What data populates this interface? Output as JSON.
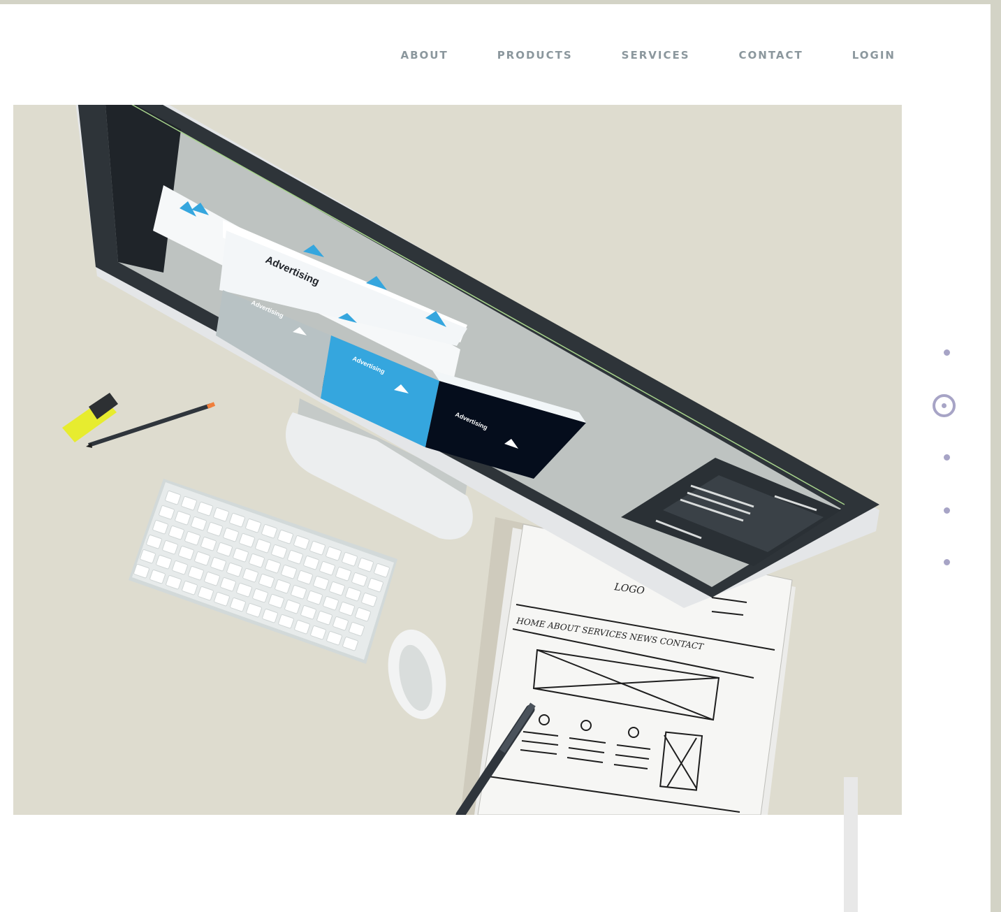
{
  "nav": {
    "items": [
      {
        "label": "ABOUT"
      },
      {
        "label": "PRODUCTS"
      },
      {
        "label": "SERVICES"
      },
      {
        "label": "CONTACT"
      },
      {
        "label": "LOGIN"
      }
    ]
  },
  "hero": {
    "screen_texts": {
      "ad1": "Advertising",
      "ad2": "Advertising",
      "ad3": "Advertising",
      "ad4": "Advertising"
    },
    "sketch_nav": "HOME ABOUT SERVICES NEWS CONTACT",
    "sketch_logo": "LOGO"
  },
  "pager": {
    "count": 5,
    "active_index": 1
  },
  "colors": {
    "hero_bg": "#dedccf",
    "nav_text": "#8b979d",
    "pager_dot": "#a7a4c6",
    "accent_blue": "#35a6de"
  }
}
